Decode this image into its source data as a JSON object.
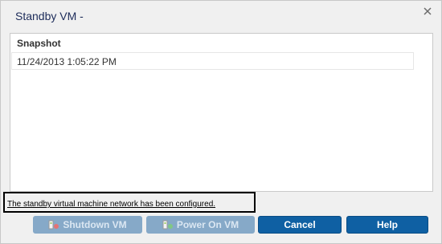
{
  "dialog": {
    "title": "Standby VM -"
  },
  "table": {
    "header": "Snapshot",
    "rows": [
      {
        "snapshot": "11/24/2013 1:05:22 PM"
      }
    ]
  },
  "status": {
    "message": "The standby virtual machine network has been configured."
  },
  "buttons": {
    "shutdown": "Shutdown VM",
    "power_on": "Power On VM",
    "cancel": "Cancel",
    "help": "Help"
  },
  "colors": {
    "primary_button": "#0f60a3",
    "disabled_button": "#86a9c8",
    "title_text": "#1d2c5a"
  }
}
